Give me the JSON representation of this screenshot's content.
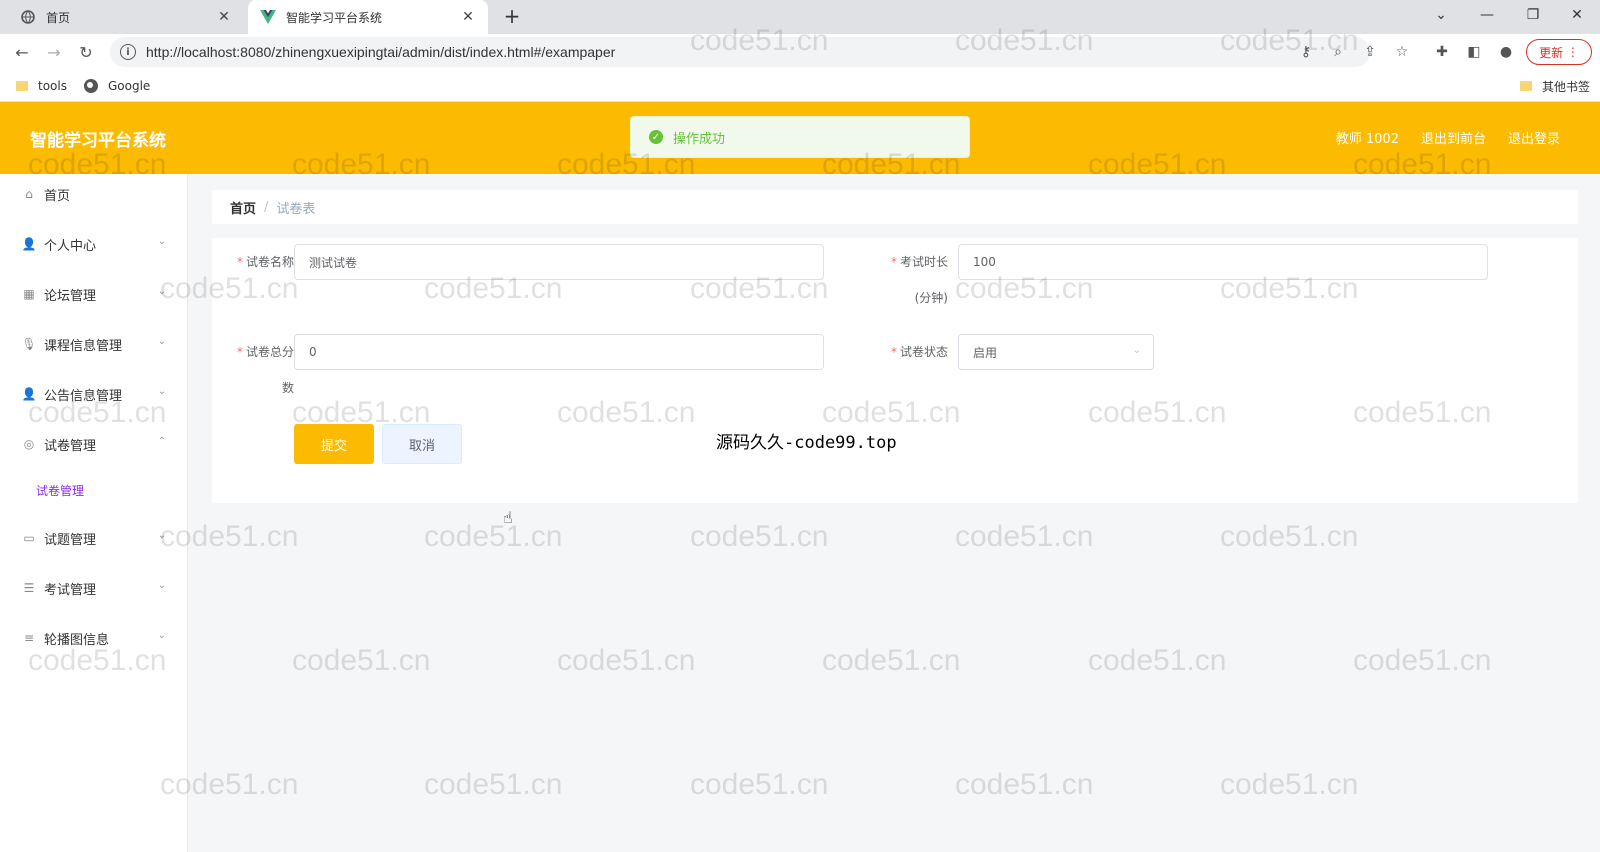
{
  "browser": {
    "tabs": [
      {
        "title": "首页",
        "active": false
      },
      {
        "title": "智能学习平台系统",
        "active": true
      }
    ],
    "url": "http://localhost:8080/zhinengxuexipingtai/admin/dist/index.html#/exampaper",
    "update_label": "更新",
    "bookmarks": [
      {
        "label": "tools",
        "icon": "folder-icon"
      },
      {
        "label": "Google",
        "icon": "globe-icon"
      }
    ],
    "other_bookmarks": "其他书签"
  },
  "header": {
    "title": "智能学习平台系统",
    "user": "教师 1002",
    "to_front": "退出到前台",
    "logout": "退出登录"
  },
  "toast": {
    "message": "操作成功",
    "color": "#67c23a"
  },
  "sidebar": {
    "items": [
      {
        "label": "首页",
        "icon": "home-icon"
      },
      {
        "label": "个人中心",
        "icon": "user-icon"
      },
      {
        "label": "论坛管理",
        "icon": "forum-icon"
      },
      {
        "label": "课程信息管理",
        "icon": "mic-icon"
      },
      {
        "label": "公告信息管理",
        "icon": "user-icon"
      },
      {
        "label": "试卷管理",
        "icon": "target-icon"
      },
      {
        "label": "试题管理",
        "icon": "card-icon"
      },
      {
        "label": "考试管理",
        "icon": "sliders-icon"
      },
      {
        "label": "轮播图信息",
        "icon": "list-icon"
      }
    ],
    "submenu": {
      "label": "试卷管理"
    }
  },
  "breadcrumb": {
    "home": "首页",
    "separator": "/",
    "current": "试卷表"
  },
  "form": {
    "name_label": "试卷名称",
    "name_value": "测试试卷",
    "duration_label": "考试时长",
    "duration_label_2": "(分钟)",
    "duration_value": "100",
    "total_label": "试卷总分",
    "total_label_2": "数",
    "total_value": "0",
    "status_label": "试卷状态",
    "status_value": "启用",
    "submit_label": "提交",
    "cancel_label": "取消"
  },
  "watermark_text": "源码久久-code99.top",
  "tiled_watermark": "code51.cn",
  "colors": {
    "brand": "#fcbb00",
    "required": "#f56c6c"
  }
}
